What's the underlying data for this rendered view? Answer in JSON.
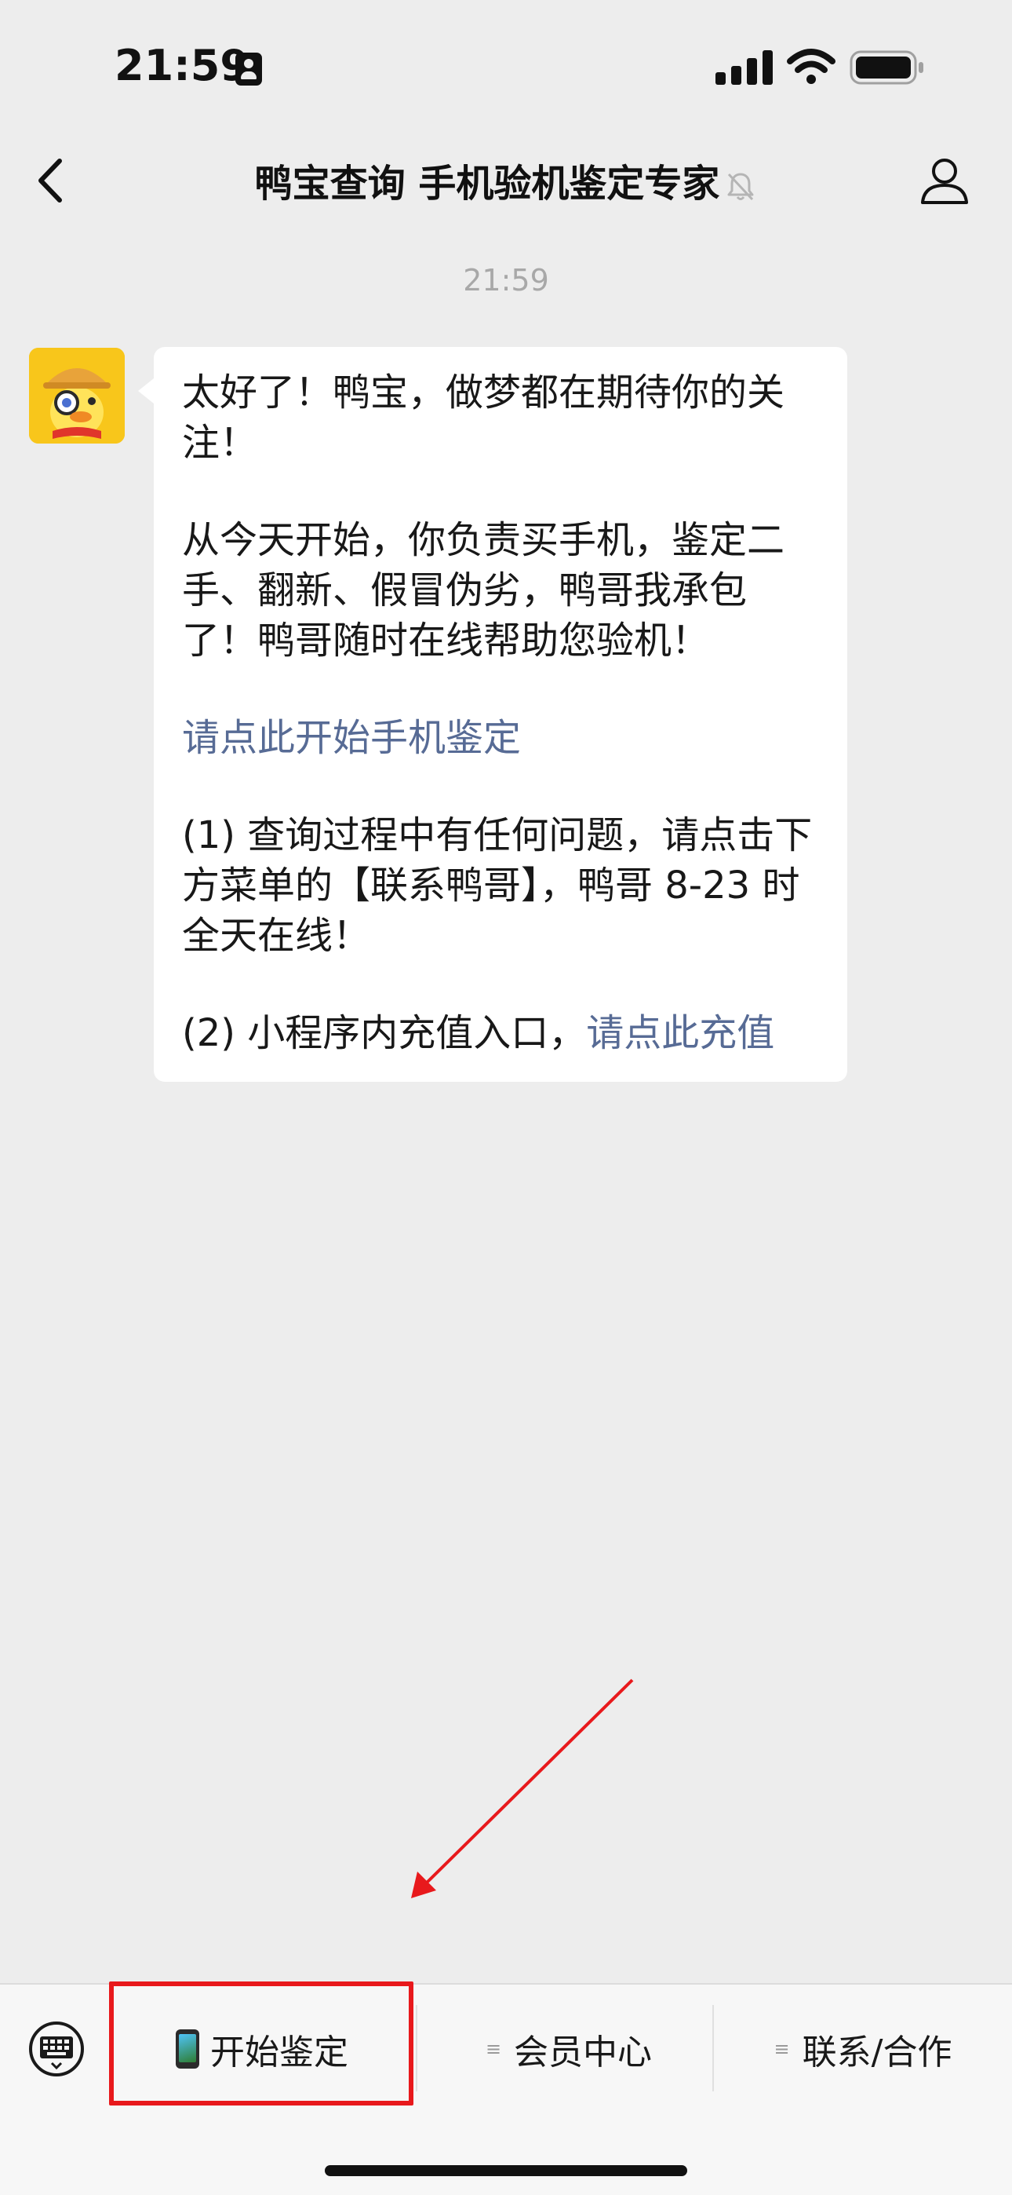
{
  "status_bar": {
    "time": "21:59"
  },
  "nav": {
    "title": "鸭宝查询 手机验机鉴定专家"
  },
  "chat": {
    "timestamp": "21:59",
    "message": {
      "para1": "太好了！鸭宝，做梦都在期待你的关注！",
      "para2": "从今天开始，你负责买手机，鉴定二手、翻新、假冒伪劣，鸭哥我承包了！鸭哥随时在线帮助您验机！",
      "link_start": "请点此开始手机鉴定",
      "para3": "(1) 查询过程中有任何问题，请点击下方菜单的【联系鸭哥】，鸭哥 8-23 时全天在线！",
      "para4_prefix": "(2) 小程序内充值入口，",
      "link_recharge": "请点此充值"
    }
  },
  "menu": {
    "item1": "开始鉴定",
    "item2": "会员中心",
    "item3": "联系/合作"
  },
  "colors": {
    "link": "#576b95",
    "annotation_red": "#e8191c",
    "background": "#ededed"
  },
  "icons": [
    "back-icon",
    "mute-icon",
    "profile-icon",
    "keyboard-icon",
    "phone-icon",
    "signal-icon",
    "wifi-icon",
    "battery-icon"
  ]
}
